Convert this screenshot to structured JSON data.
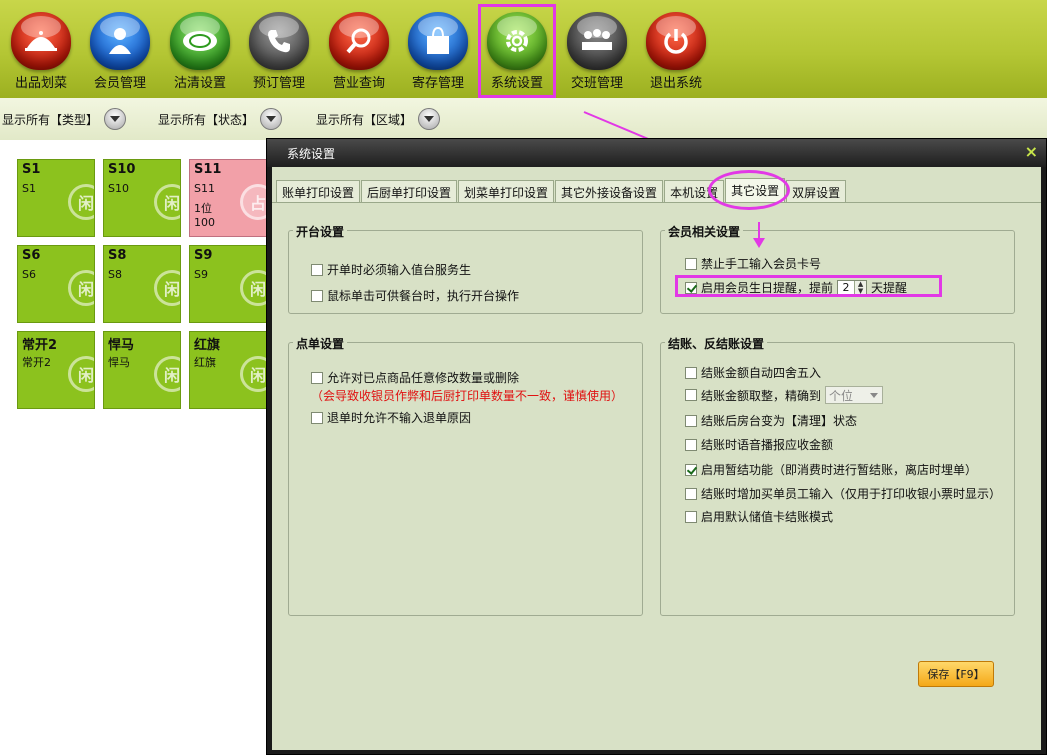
{
  "toolbar": {
    "items": [
      {
        "label": "出品划菜",
        "icon": "cloche-icon",
        "color": "#c01808"
      },
      {
        "label": "会员管理",
        "icon": "member-icon",
        "color": "#1258c8"
      },
      {
        "label": "沽清设置",
        "icon": "plate-icon",
        "color": "#2e9a1e"
      },
      {
        "label": "预订管理",
        "icon": "phone-icon",
        "color": "#4a4a4a"
      },
      {
        "label": "营业查询",
        "icon": "magnifier-icon",
        "color": "#c01808"
      },
      {
        "label": "寄存管理",
        "icon": "bag-icon",
        "color": "#1458c0"
      },
      {
        "label": "系统设置",
        "icon": "gear-icon",
        "color": "#4aa01a"
      },
      {
        "label": "交班管理",
        "icon": "meeting-icon",
        "color": "#3e3e3e"
      },
      {
        "label": "退出系统",
        "icon": "power-icon",
        "color": "#c01808"
      }
    ]
  },
  "filters": [
    {
      "label": "显示所有【类型】"
    },
    {
      "label": "显示所有【状态】"
    },
    {
      "label": "显示所有【区域】"
    }
  ],
  "tables": [
    {
      "name": "S1",
      "sub": "S1",
      "stamp": "闲",
      "occupied": false
    },
    {
      "name": "S10",
      "sub": "S10",
      "stamp": "闲",
      "occupied": false
    },
    {
      "name": "S11",
      "sub": "S11",
      "guests": "1位",
      "amount": "100",
      "stamp": "占",
      "occupied": true
    },
    {
      "name": "S6",
      "sub": "S6",
      "stamp": "闲",
      "occupied": false
    },
    {
      "name": "S8",
      "sub": "S8",
      "stamp": "闲",
      "occupied": false
    },
    {
      "name": "S9",
      "sub": "S9",
      "stamp": "闲",
      "occupied": false
    },
    {
      "name": "常开2",
      "sub": "常开2",
      "stamp": "闲",
      "occupied": false
    },
    {
      "name": "悍马",
      "sub": "悍马",
      "stamp": "闲",
      "occupied": false
    },
    {
      "name": "红旗",
      "sub": "红旗",
      "stamp": "闲",
      "occupied": false
    }
  ],
  "dialog": {
    "title": "系统设置",
    "close": "×",
    "tabs": [
      {
        "label": "账单打印设置"
      },
      {
        "label": "后厨单打印设置"
      },
      {
        "label": "划菜单打印设置"
      },
      {
        "label": "其它外接设备设置"
      },
      {
        "label": "本机设置"
      },
      {
        "label": "其它设置",
        "active": true
      },
      {
        "label": "双屏设置"
      }
    ],
    "open_settings": {
      "title": "开台设置",
      "options": [
        {
          "label": "开单时必须输入值台服务生",
          "checked": false
        },
        {
          "label": "鼠标单击可供餐台时，执行开台操作",
          "checked": false
        }
      ]
    },
    "order_settings": {
      "title": "点单设置",
      "options": [
        {
          "label": "允许对已点商品任意修改数量或删除",
          "checked": false
        },
        {
          "label": "退单时允许不输入退单原因",
          "checked": false
        }
      ],
      "warning": "（会导致收银员作弊和后厨打印单数量不一致，谨慎使用）"
    },
    "member_settings": {
      "title": "会员相关设置",
      "disable_manual": {
        "label": "禁止手工输入会员卡号",
        "checked": false
      },
      "birthday": {
        "label_before": "启用会员生日提醒，提前",
        "days": "2",
        "label_after": "天提醒",
        "checked": true
      }
    },
    "checkout_settings": {
      "title": "结账、反结账设置",
      "opt_round": {
        "label": "结账金额自动四舍五入",
        "checked": false
      },
      "opt_precision": {
        "label": "结账金额取整，精确到",
        "select": "个位",
        "checked": false
      },
      "opt_clean": {
        "label": "结账后房台变为【清理】状态",
        "checked": false
      },
      "opt_voice": {
        "label": "结账时语音播报应收金额",
        "checked": false
      },
      "opt_suspend": {
        "label": "启用暂结功能（即消费时进行暂结账，离店时埋单）",
        "checked": true
      },
      "opt_staff": {
        "label": "结账时增加买单员工输入（仅用于打印收银小票时显示）",
        "checked": false
      },
      "opt_stored": {
        "label": "启用默认储值卡结账模式",
        "checked": false
      }
    },
    "save_label": "保存【F9】"
  },
  "colors": {
    "toolbar": "#b4c634",
    "tile_free": "#8cc21e",
    "tile_occupied": "#f2a0a8",
    "dialog_body": "#d8e1c6",
    "warning": "#e01010",
    "annotation": "#e238e6"
  }
}
